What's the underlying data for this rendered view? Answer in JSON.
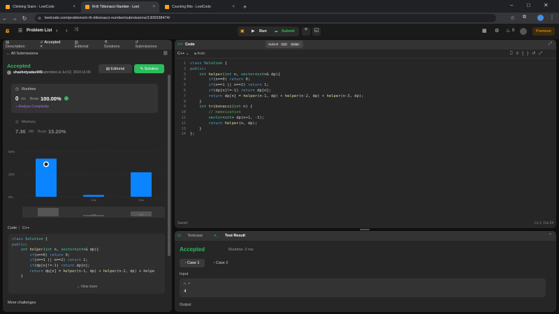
{
  "browser": {
    "tabs": [
      {
        "title": "Climbing Stairs - LeetCode"
      },
      {
        "title": "N-th Tribonacci Number - Leet"
      },
      {
        "title": "Counting Bits - LeetCode"
      }
    ],
    "url": "leetcode.com/problems/n-th-tribonacci-number/submissions/1306938474/"
  },
  "toolbar": {
    "problem_list": "Problem List",
    "run": "Run",
    "submit": "Submit",
    "streak": "0",
    "premium": "Premium"
  },
  "left": {
    "tabs": [
      "Description",
      "Accepted",
      "Editorial",
      "Solutions",
      "Submissions"
    ],
    "back": "All Submissions",
    "status": "Accepted",
    "user": "shashotyadav945",
    "submitted": "submitted at Jul 02, 2024 16:06",
    "editorial_btn": "Editorial",
    "solution_btn": "Solution",
    "runtime": {
      "label": "Runtime",
      "value": "0",
      "unit": "ms",
      "beats_label": "Beats",
      "beats": "100.00%",
      "analyze": "Analyze Complexity"
    },
    "memory": {
      "label": "Memory",
      "value": "7.36",
      "unit": "MB",
      "beats_label": "Beats",
      "beats": "15.20%"
    },
    "chart": {
      "yticks": [
        "50%",
        "25%",
        "0%"
      ],
      "xlabels": [
        "1ms",
        "2ms"
      ],
      "mini_labels": [
        "1ms",
        "2ms"
      ]
    },
    "code_header": {
      "label": "Code",
      "lang": "C++"
    },
    "snippet": [
      "class Solution {",
      "public:",
      "    int helper(int n, vector<int>& dp){",
      "        if(n==0) return 0;",
      "        if(n==1 || n==2) return 1;",
      "        if(dp[n]!=-1) return dp[n];",
      "        return dp[n] = helper(n-1, dp) + helper(n-2, dp) + helpe",
      "    }"
    ],
    "view_more": "View more",
    "more_challenges": "More challenges"
  },
  "chart_data": {
    "type": "bar",
    "categories": [
      "0ms",
      "1ms",
      "2ms"
    ],
    "values": [
      42,
      2,
      27
    ],
    "ylim": [
      0,
      50
    ],
    "ylabel": "",
    "xlabel": ""
  },
  "editor": {
    "title": "Code",
    "lang": "C++",
    "auto": "Auto",
    "tooltip": {
      "a": "Submit",
      "b": "Ctrl",
      "c": "Enter"
    },
    "lines": [
      "class Solution {",
      "public:",
      "    int helper(int n, vector<int>& dp){",
      "        if(n==0) return 0;",
      "        if(n==1 || n==2) return 1;",
      "        if(dp[n]!=-1) return dp[n];",
      "        return dp[n] = helper(n-1, dp) + helper(n-2, dp) + helper(n-3, dp);",
      "    }",
      "    int tribonacci(int n) {",
      "        // memoization",
      "        vector<int> dp(n+1, -1);",
      "        return helper(n, dp);",
      "    }",
      "};"
    ],
    "saved": "Saved",
    "cursor": "Ln 1, Col 24"
  },
  "result": {
    "tabs": [
      "Testcase",
      "Test Result"
    ],
    "status": "Accepted",
    "runtime": "Runtime: 2 ms",
    "cases": [
      "Case 1",
      "Case 2"
    ],
    "input_label": "Input",
    "var": "n =",
    "var_value": "4",
    "output_label": "Output"
  }
}
